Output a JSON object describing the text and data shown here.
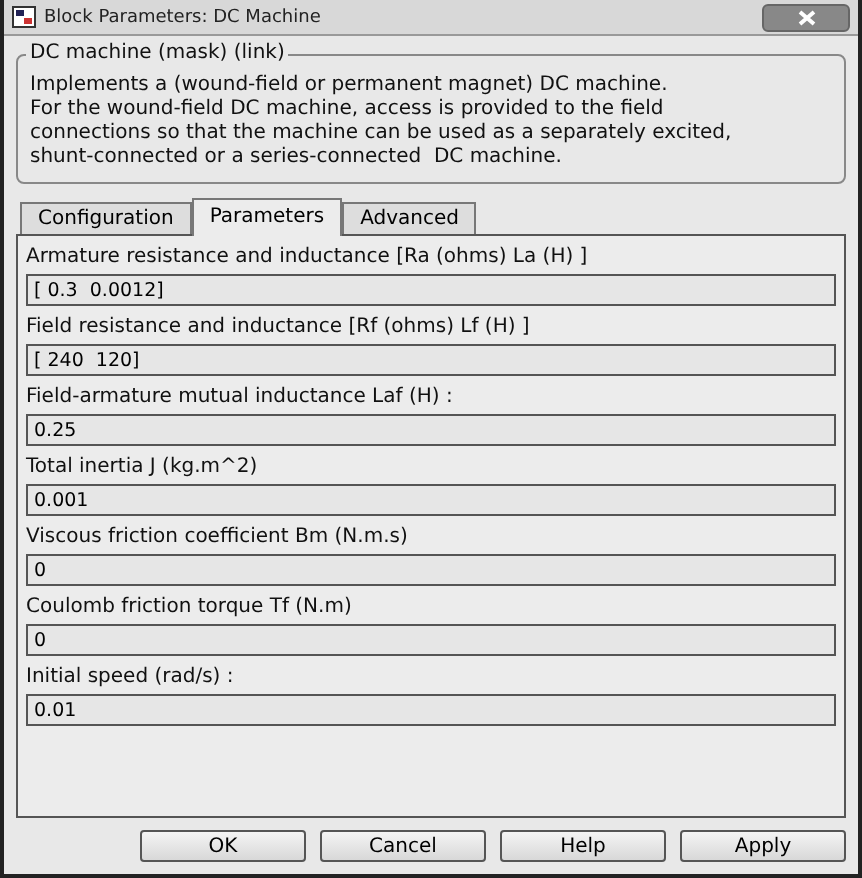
{
  "window": {
    "title": "Block Parameters: DC Machine"
  },
  "group": {
    "title": "DC machine (mask) (link)",
    "description": "Implements a (wound-field or permanent magnet) DC machine.\nFor the wound-field DC machine, access is provided to the field\nconnections so that the machine can be used as a separately excited,\nshunt-connected or a series-connected  DC machine."
  },
  "tabs": [
    {
      "label": "Configuration",
      "selected": false
    },
    {
      "label": "Parameters",
      "selected": true
    },
    {
      "label": "Advanced",
      "selected": false
    }
  ],
  "parameters": [
    {
      "label": "Armature resistance and inductance [Ra (ohms) La (H) ]",
      "value": "[ 0.3  0.0012]"
    },
    {
      "label": "Field resistance and inductance [Rf (ohms) Lf (H) ]",
      "value": "[ 240  120]"
    },
    {
      "label": "Field-armature mutual inductance Laf (H) :",
      "value": "0.25"
    },
    {
      "label": "Total inertia J (kg.m^2)",
      "value": "0.001"
    },
    {
      "label": "Viscous friction coefficient Bm (N.m.s)",
      "value": "0"
    },
    {
      "label": "Coulomb friction torque Tf (N.m)",
      "value": "0"
    },
    {
      "label": "Initial speed (rad/s) :",
      "value": "0.01"
    }
  ],
  "buttons": [
    "OK",
    "Cancel",
    "Help",
    "Apply"
  ]
}
